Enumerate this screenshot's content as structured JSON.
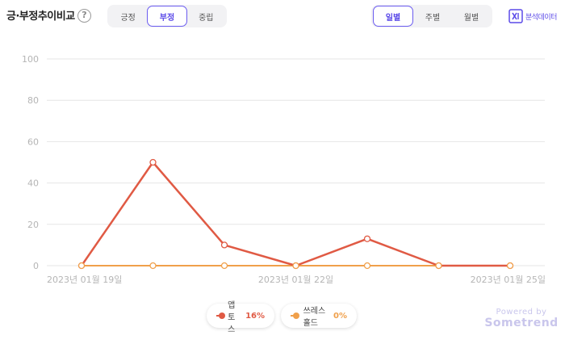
{
  "header": {
    "title": "긍·부정추이비교",
    "help_label": "?",
    "sentiment_tabs": [
      {
        "label": "긍정",
        "active": false
      },
      {
        "label": "부정",
        "active": true
      },
      {
        "label": "중립",
        "active": false
      }
    ],
    "period_tabs": [
      {
        "label": "일별",
        "active": true
      },
      {
        "label": "주별",
        "active": false
      },
      {
        "label": "월별",
        "active": false
      }
    ],
    "download_label": "분석데이터"
  },
  "chart_data": {
    "type": "line",
    "x": [
      "2023-01-19",
      "2023-01-20",
      "2023-01-21",
      "2023-01-22",
      "2023-01-23",
      "2023-01-24",
      "2023-01-25"
    ],
    "x_tick_labels": [
      {
        "index": 0,
        "label": "2023년 01월 19일"
      },
      {
        "index": 3,
        "label": "2023년 01월 22일"
      },
      {
        "index": 6,
        "label": "2023년 01월 25일"
      }
    ],
    "ylim": [
      0,
      100
    ],
    "yticks": [
      0,
      20,
      40,
      60,
      80,
      100
    ],
    "grid": true,
    "legend_placement": "bottom-center",
    "series": [
      {
        "name": "앱토스",
        "percent": "16%",
        "color": "#e05a44",
        "values": [
          0,
          50,
          10,
          0,
          13,
          0,
          0
        ]
      },
      {
        "name": "쓰레스홀드",
        "percent": "0%",
        "color": "#f0a04b",
        "values": [
          0,
          0,
          0,
          0,
          0,
          0,
          0
        ]
      }
    ]
  },
  "footer": {
    "powered_line1": "Powered by",
    "powered_line2": "Sometrend"
  }
}
